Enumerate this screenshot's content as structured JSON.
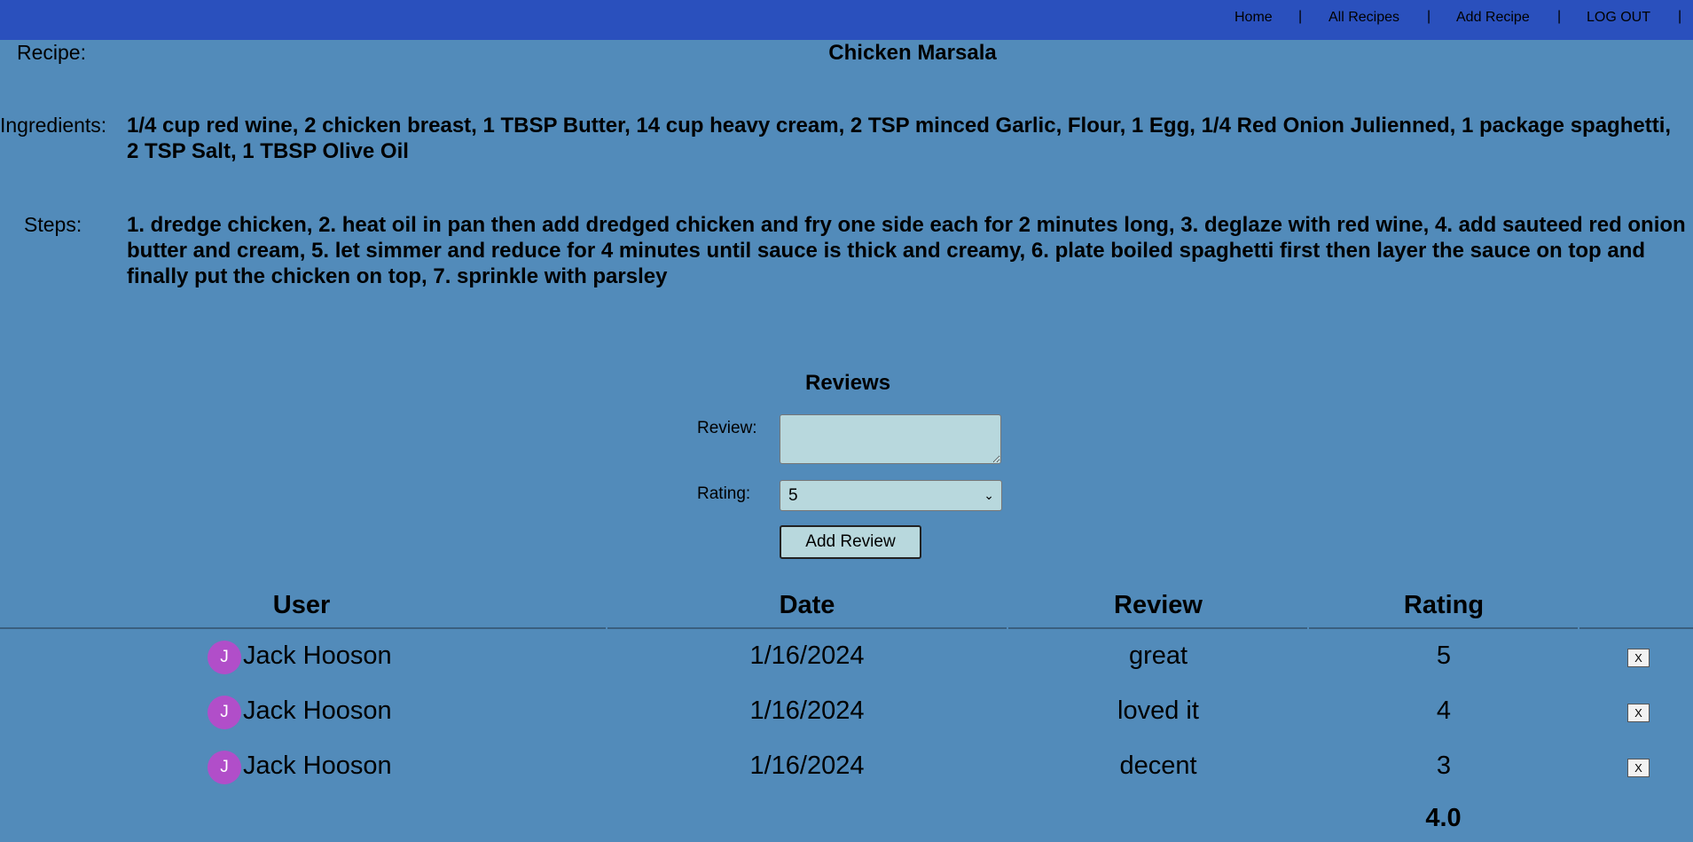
{
  "nav": {
    "items": [
      {
        "label": "Home"
      },
      {
        "label": "All Recipes"
      },
      {
        "label": "Add Recipe"
      },
      {
        "label": "LOG OUT"
      }
    ],
    "separator": "|"
  },
  "recipe": {
    "label": "Recipe:",
    "name": "Chicken Marsala",
    "ingredients_label": "Ingredients:",
    "ingredients": "1/4 cup red wine, 2 chicken breast, 1 TBSP Butter, 14 cup heavy cream, 2 TSP minced Garlic, Flour, 1 Egg, 1/4 Red Onion Julienned, 1 package spaghetti, 2 TSP Salt, 1 TBSP Olive Oil",
    "steps_label": "Steps:",
    "steps": "1. dredge chicken, 2. heat oil in pan then add dredged chicken and fry one side each for 2 minutes long, 3. deglaze with red wine, 4. add sauteed red onion butter and cream, 5. let simmer and reduce for 4 minutes until sauce is thick and creamy, 6. plate boiled spaghetti first then layer the sauce on top and finally put the chicken on top, 7. sprinkle with parsley"
  },
  "review_form": {
    "heading": "Reviews",
    "review_label": "Review:",
    "review_value": "",
    "rating_label": "Rating:",
    "rating_value": "5",
    "submit_label": "Add Review"
  },
  "reviews_table": {
    "columns": [
      "User",
      "Date",
      "Review",
      "Rating"
    ],
    "rows": [
      {
        "avatar": "J",
        "user": "Jack Hooson",
        "date": "1/16/2024",
        "review": "great",
        "rating": "5",
        "delete_label": "X"
      },
      {
        "avatar": "J",
        "user": "Jack Hooson",
        "date": "1/16/2024",
        "review": "loved it",
        "rating": "4",
        "delete_label": "X"
      },
      {
        "avatar": "J",
        "user": "Jack Hooson",
        "date": "1/16/2024",
        "review": "decent",
        "rating": "3",
        "delete_label": "X"
      }
    ],
    "average_rating": "4.0"
  },
  "colors": {
    "page_background": "#528bba",
    "nav_background": "#2a50bd",
    "input_background": "#b8d8dd",
    "avatar_background": "#b14ec9"
  }
}
